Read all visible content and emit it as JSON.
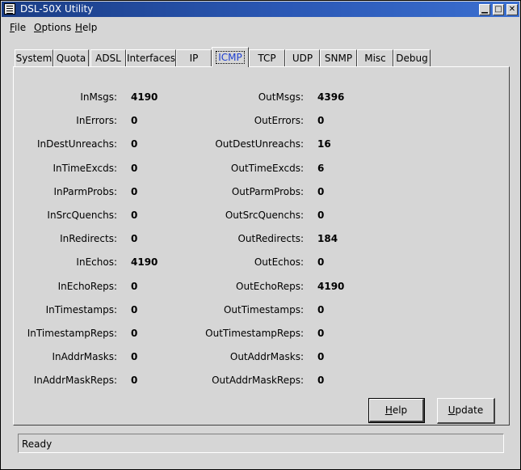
{
  "window": {
    "title": "DSL-50X Utility",
    "controls": {
      "minimize": "▁",
      "maximize": "□",
      "close": "✕"
    }
  },
  "menubar": [
    {
      "key": "F",
      "rest": "ile"
    },
    {
      "key": "O",
      "rest": "ptions"
    },
    {
      "key": "H",
      "rest": "elp"
    }
  ],
  "tabs": [
    "System",
    "Quota",
    "ADSL",
    "Interfaces",
    "IP",
    "ICMP",
    "TCP",
    "UDP",
    "SNMP",
    "Misc",
    "Debug"
  ],
  "active_tab": "ICMP",
  "stats": {
    "in": [
      {
        "label": "InMsgs:",
        "value": "4190"
      },
      {
        "label": "InErrors:",
        "value": "0"
      },
      {
        "label": "InDestUnreachs:",
        "value": "0"
      },
      {
        "label": "InTimeExcds:",
        "value": "0"
      },
      {
        "label": "InParmProbs:",
        "value": "0"
      },
      {
        "label": "InSrcQuenchs:",
        "value": "0"
      },
      {
        "label": "InRedirects:",
        "value": "0"
      },
      {
        "label": "InEchos:",
        "value": "4190"
      },
      {
        "label": "InEchoReps:",
        "value": "0"
      },
      {
        "label": "InTimestamps:",
        "value": "0"
      },
      {
        "label": "InTimestampReps:",
        "value": "0"
      },
      {
        "label": "InAddrMasks:",
        "value": "0"
      },
      {
        "label": "InAddrMaskReps:",
        "value": "0"
      }
    ],
    "out": [
      {
        "label": "OutMsgs:",
        "value": "4396"
      },
      {
        "label": "OutErrors:",
        "value": "0"
      },
      {
        "label": "OutDestUnreachs:",
        "value": "16"
      },
      {
        "label": "OutTimeExcds:",
        "value": "6"
      },
      {
        "label": "OutParmProbs:",
        "value": "0"
      },
      {
        "label": "OutSrcQuenchs:",
        "value": "0"
      },
      {
        "label": "OutRedirects:",
        "value": "184"
      },
      {
        "label": "OutEchos:",
        "value": "0"
      },
      {
        "label": "OutEchoReps:",
        "value": "4190"
      },
      {
        "label": "OutTimestamps:",
        "value": "0"
      },
      {
        "label": "OutTimestampReps:",
        "value": "0"
      },
      {
        "label": "OutAddrMasks:",
        "value": "0"
      },
      {
        "label": "OutAddrMaskReps:",
        "value": "0"
      }
    ]
  },
  "buttons": {
    "help": {
      "key": "H",
      "rest": "elp"
    },
    "update": {
      "key": "U",
      "rest": "pdate"
    }
  },
  "status": "Ready",
  "colors": {
    "titlebar": "#2b58b5",
    "active_tab_text": "#1e3fd0",
    "background": "#d6d6d6"
  }
}
